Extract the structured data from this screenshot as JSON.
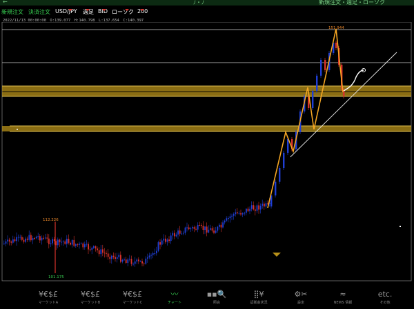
{
  "topbar": {
    "left_glyph": "←",
    "center_glyph": "ﾉ・ﾉ",
    "right_text": "新規注文・週足・ローソク"
  },
  "toolbar": {
    "new_order": "新規注文",
    "close_order": "決済注文",
    "symbol": "USD/JPY",
    "period": "週足",
    "price_type": "BID",
    "chart_type": "ローソク",
    "count": "200"
  },
  "ohlc": {
    "text": "2022/11/13 00:00:00　O:139.077　H:140.798　L:137.654　C:140.397"
  },
  "chart_labels": {
    "high_marker": "151.944",
    "mid_high": "112.226",
    "low_marker": "101.175"
  },
  "colors": {
    "bull": "#1f3fd6",
    "bear": "#d9332b",
    "zone": "#b8911a",
    "zigzag": "#f5a623",
    "active": "#39d353"
  },
  "nav": [
    {
      "icon": "¥€$£",
      "label": "マーケットA",
      "icon_name": "currency-icon"
    },
    {
      "icon": "¥€$£",
      "label": "マーケットB",
      "icon_name": "currency-icon"
    },
    {
      "icon": "¥€$£",
      "label": "マーケットC",
      "icon_name": "currency-icon"
    },
    {
      "icon": "〰",
      "label": "チャート",
      "icon_name": "chart-icon"
    },
    {
      "icon": "▪▪🔍",
      "label": "照会",
      "icon_name": "search-icon"
    },
    {
      "icon": "⣿¥",
      "label": "証拠金状況",
      "icon_name": "margin-icon"
    },
    {
      "icon": "⚙✂",
      "label": "設定",
      "icon_name": "settings-icon"
    },
    {
      "icon": "≈",
      "label": "NEWS 情報",
      "icon_name": "news-icon"
    },
    {
      "icon": "etc.",
      "label": "その他",
      "icon_name": "more-icon"
    }
  ]
}
